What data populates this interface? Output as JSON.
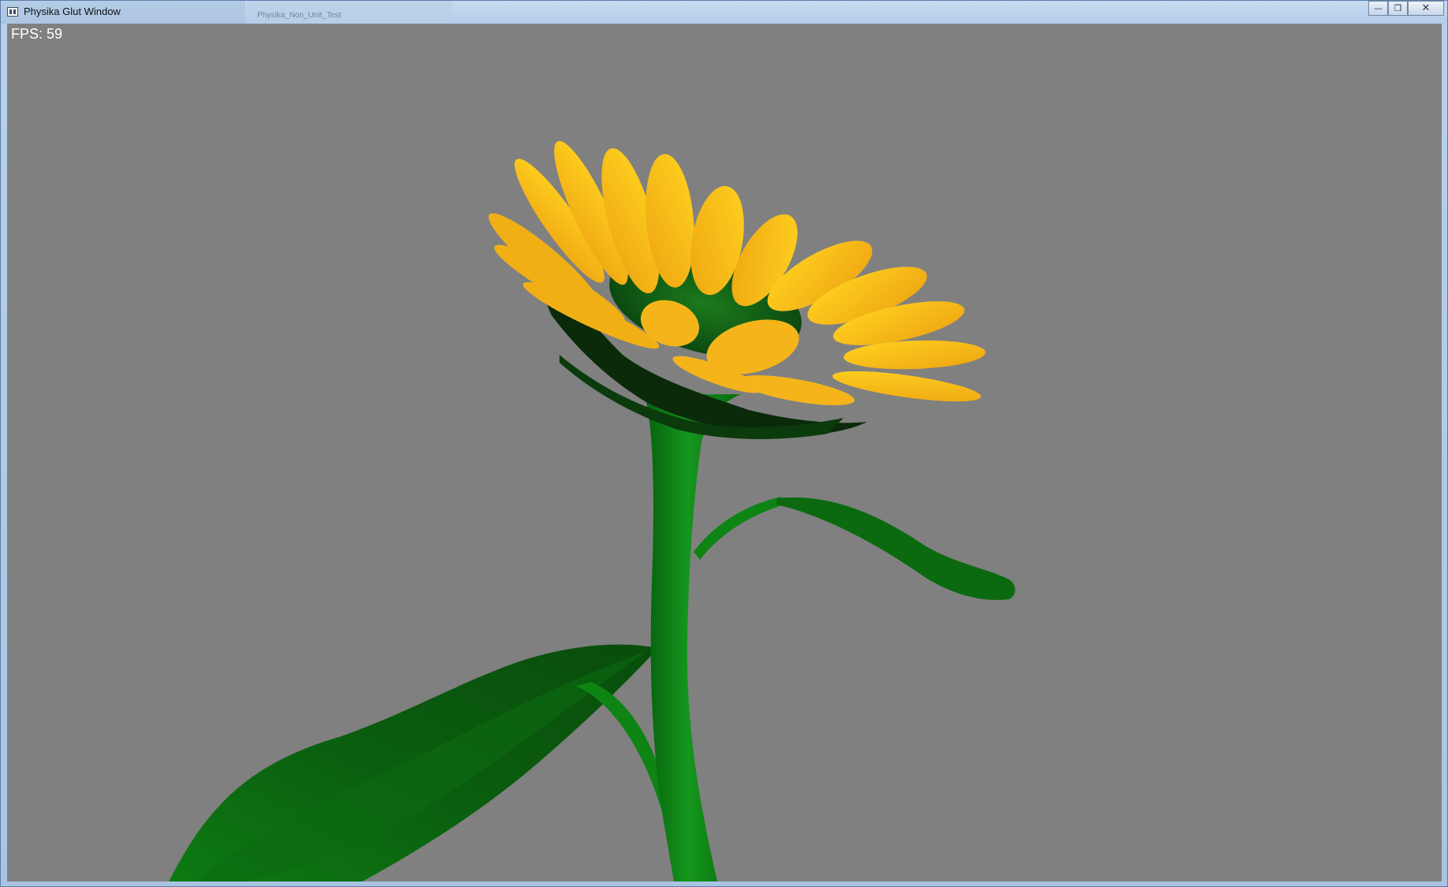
{
  "window": {
    "title": "Physika Glut Window",
    "background_title": "Physika_Non_Unit_Test",
    "minimize_glyph": "—",
    "restore_glyph": "❐",
    "close_glyph": "✕"
  },
  "overlay": {
    "fps_text": "FPS: 59"
  },
  "colors": {
    "viewport_background": "#808080",
    "petal": "#f4b41a",
    "petal_highlight": "#ffd21f",
    "stem": "#0b7a12",
    "leaf": "#0a5a0e",
    "seed_disk": "#145a14"
  },
  "icons": {
    "app": "app-window-icon",
    "minimize": "minimize-icon",
    "restore": "restore-icon",
    "close": "close-icon"
  }
}
